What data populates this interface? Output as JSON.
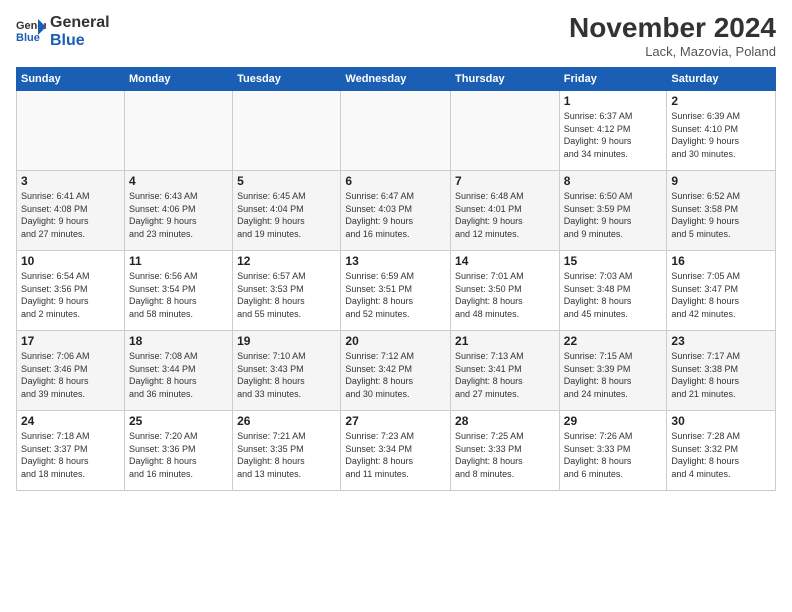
{
  "logo": {
    "line1": "General",
    "line2": "Blue"
  },
  "title": "November 2024",
  "location": "Lack, Mazovia, Poland",
  "days_header": [
    "Sunday",
    "Monday",
    "Tuesday",
    "Wednesday",
    "Thursday",
    "Friday",
    "Saturday"
  ],
  "weeks": [
    [
      {
        "num": "",
        "info": ""
      },
      {
        "num": "",
        "info": ""
      },
      {
        "num": "",
        "info": ""
      },
      {
        "num": "",
        "info": ""
      },
      {
        "num": "",
        "info": ""
      },
      {
        "num": "1",
        "info": "Sunrise: 6:37 AM\nSunset: 4:12 PM\nDaylight: 9 hours\nand 34 minutes."
      },
      {
        "num": "2",
        "info": "Sunrise: 6:39 AM\nSunset: 4:10 PM\nDaylight: 9 hours\nand 30 minutes."
      }
    ],
    [
      {
        "num": "3",
        "info": "Sunrise: 6:41 AM\nSunset: 4:08 PM\nDaylight: 9 hours\nand 27 minutes."
      },
      {
        "num": "4",
        "info": "Sunrise: 6:43 AM\nSunset: 4:06 PM\nDaylight: 9 hours\nand 23 minutes."
      },
      {
        "num": "5",
        "info": "Sunrise: 6:45 AM\nSunset: 4:04 PM\nDaylight: 9 hours\nand 19 minutes."
      },
      {
        "num": "6",
        "info": "Sunrise: 6:47 AM\nSunset: 4:03 PM\nDaylight: 9 hours\nand 16 minutes."
      },
      {
        "num": "7",
        "info": "Sunrise: 6:48 AM\nSunset: 4:01 PM\nDaylight: 9 hours\nand 12 minutes."
      },
      {
        "num": "8",
        "info": "Sunrise: 6:50 AM\nSunset: 3:59 PM\nDaylight: 9 hours\nand 9 minutes."
      },
      {
        "num": "9",
        "info": "Sunrise: 6:52 AM\nSunset: 3:58 PM\nDaylight: 9 hours\nand 5 minutes."
      }
    ],
    [
      {
        "num": "10",
        "info": "Sunrise: 6:54 AM\nSunset: 3:56 PM\nDaylight: 9 hours\nand 2 minutes."
      },
      {
        "num": "11",
        "info": "Sunrise: 6:56 AM\nSunset: 3:54 PM\nDaylight: 8 hours\nand 58 minutes."
      },
      {
        "num": "12",
        "info": "Sunrise: 6:57 AM\nSunset: 3:53 PM\nDaylight: 8 hours\nand 55 minutes."
      },
      {
        "num": "13",
        "info": "Sunrise: 6:59 AM\nSunset: 3:51 PM\nDaylight: 8 hours\nand 52 minutes."
      },
      {
        "num": "14",
        "info": "Sunrise: 7:01 AM\nSunset: 3:50 PM\nDaylight: 8 hours\nand 48 minutes."
      },
      {
        "num": "15",
        "info": "Sunrise: 7:03 AM\nSunset: 3:48 PM\nDaylight: 8 hours\nand 45 minutes."
      },
      {
        "num": "16",
        "info": "Sunrise: 7:05 AM\nSunset: 3:47 PM\nDaylight: 8 hours\nand 42 minutes."
      }
    ],
    [
      {
        "num": "17",
        "info": "Sunrise: 7:06 AM\nSunset: 3:46 PM\nDaylight: 8 hours\nand 39 minutes."
      },
      {
        "num": "18",
        "info": "Sunrise: 7:08 AM\nSunset: 3:44 PM\nDaylight: 8 hours\nand 36 minutes."
      },
      {
        "num": "19",
        "info": "Sunrise: 7:10 AM\nSunset: 3:43 PM\nDaylight: 8 hours\nand 33 minutes."
      },
      {
        "num": "20",
        "info": "Sunrise: 7:12 AM\nSunset: 3:42 PM\nDaylight: 8 hours\nand 30 minutes."
      },
      {
        "num": "21",
        "info": "Sunrise: 7:13 AM\nSunset: 3:41 PM\nDaylight: 8 hours\nand 27 minutes."
      },
      {
        "num": "22",
        "info": "Sunrise: 7:15 AM\nSunset: 3:39 PM\nDaylight: 8 hours\nand 24 minutes."
      },
      {
        "num": "23",
        "info": "Sunrise: 7:17 AM\nSunset: 3:38 PM\nDaylight: 8 hours\nand 21 minutes."
      }
    ],
    [
      {
        "num": "24",
        "info": "Sunrise: 7:18 AM\nSunset: 3:37 PM\nDaylight: 8 hours\nand 18 minutes."
      },
      {
        "num": "25",
        "info": "Sunrise: 7:20 AM\nSunset: 3:36 PM\nDaylight: 8 hours\nand 16 minutes."
      },
      {
        "num": "26",
        "info": "Sunrise: 7:21 AM\nSunset: 3:35 PM\nDaylight: 8 hours\nand 13 minutes."
      },
      {
        "num": "27",
        "info": "Sunrise: 7:23 AM\nSunset: 3:34 PM\nDaylight: 8 hours\nand 11 minutes."
      },
      {
        "num": "28",
        "info": "Sunrise: 7:25 AM\nSunset: 3:33 PM\nDaylight: 8 hours\nand 8 minutes."
      },
      {
        "num": "29",
        "info": "Sunrise: 7:26 AM\nSunset: 3:33 PM\nDaylight: 8 hours\nand 6 minutes."
      },
      {
        "num": "30",
        "info": "Sunrise: 7:28 AM\nSunset: 3:32 PM\nDaylight: 8 hours\nand 4 minutes."
      }
    ]
  ]
}
